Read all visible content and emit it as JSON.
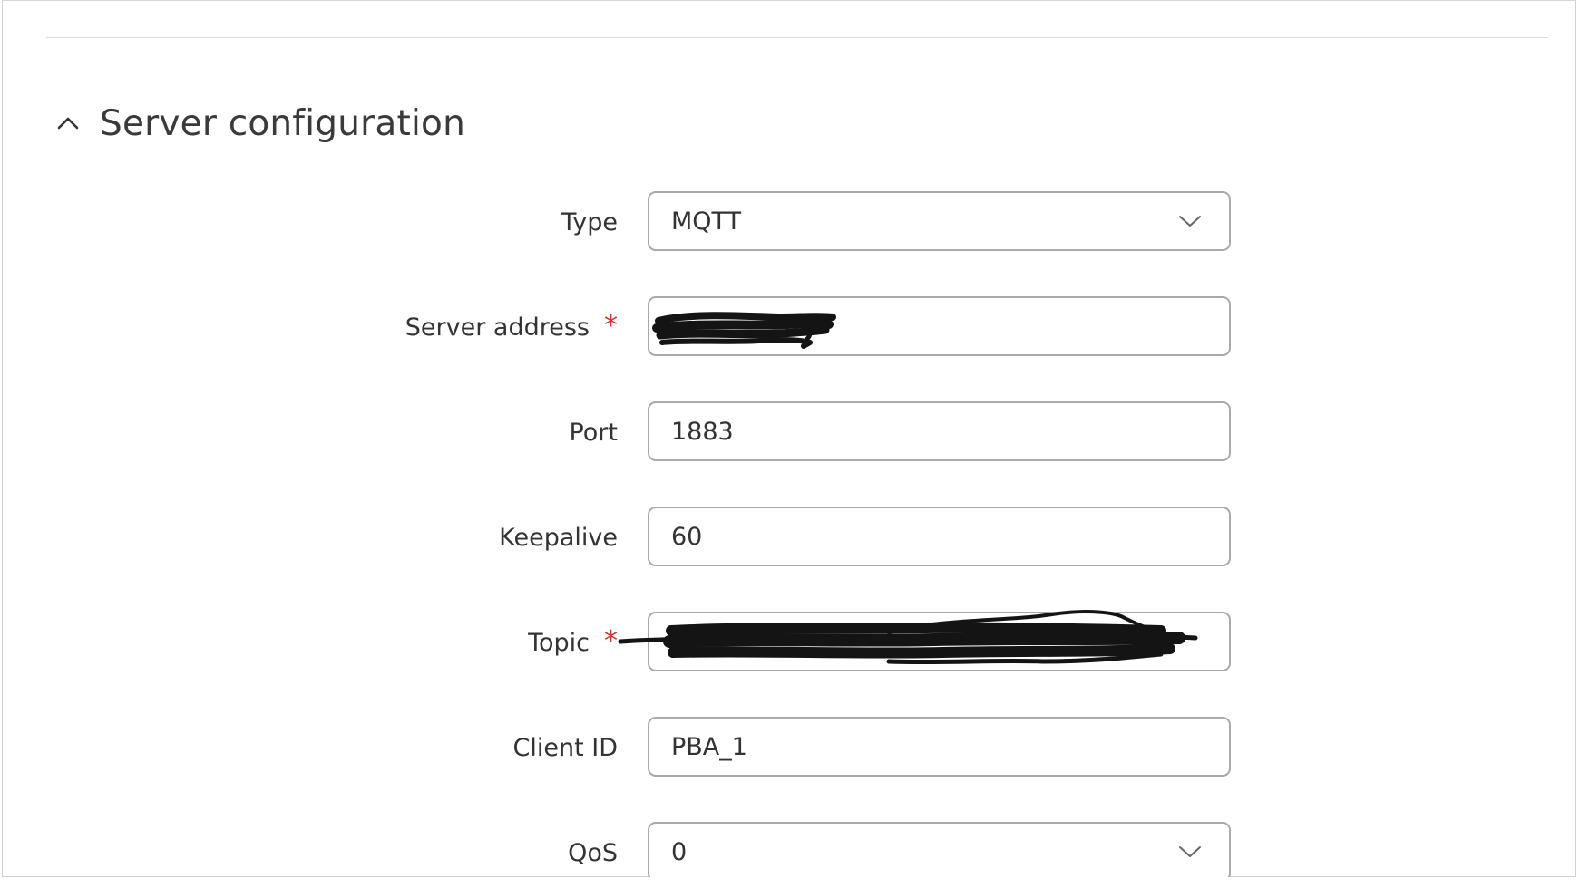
{
  "section": {
    "title": "Server configuration",
    "expanded": true,
    "toggle_icon": "chevron-up-icon"
  },
  "form": {
    "type": {
      "label": "Type",
      "value": "MQTT",
      "control": "select"
    },
    "server_address": {
      "label": "Server address",
      "required_mark": "*",
      "value": ""
    },
    "port": {
      "label": "Port",
      "value": "1883"
    },
    "keepalive": {
      "label": "Keepalive",
      "value": "60"
    },
    "topic": {
      "label": "Topic",
      "required_mark": "*",
      "value": ""
    },
    "client_id": {
      "label": "Client ID",
      "value": "PBA_1"
    },
    "qos": {
      "label": "QoS",
      "value": "0",
      "control": "select"
    }
  },
  "colors": {
    "required": "#d0342c",
    "field_border": "#a9a9a9",
    "text": "#333333",
    "redaction": "#141414"
  }
}
